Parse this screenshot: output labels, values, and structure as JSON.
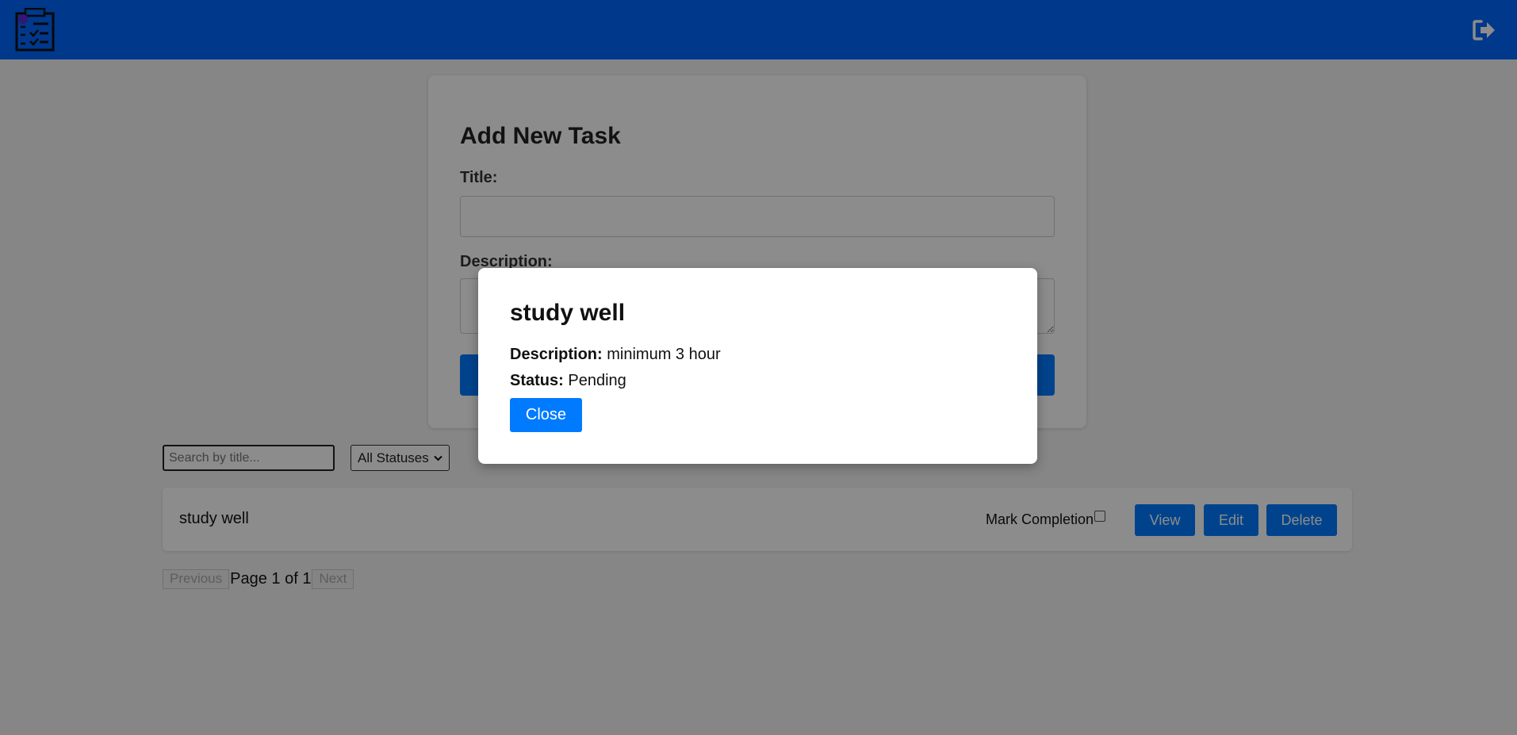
{
  "colors": {
    "navbar": "#0066ff",
    "primary_button": "#007bff",
    "page_background": "#f4f4f4",
    "overlay": "rgba(0,0,0,0.45)"
  },
  "navbar": {
    "logo_icon": "task-checklist-icon",
    "logout_icon": "sign-out-icon"
  },
  "form": {
    "heading": "Add New Task",
    "title_label": "Title:",
    "title_value": "",
    "description_label": "Description:",
    "description_value": ""
  },
  "filters": {
    "search_placeholder": "Search by title...",
    "search_value": "",
    "status_selected": "All Statuses"
  },
  "tasks": [
    {
      "title": "study well",
      "mark_completion_label": "Mark Completion",
      "completed": false,
      "view_label": "View",
      "edit_label": "Edit",
      "delete_label": "Delete"
    }
  ],
  "pagination": {
    "previous_label": "Previous",
    "page_text": "Page 1 of 1",
    "next_label": "Next"
  },
  "modal": {
    "title": "study well",
    "description_label": "Description:",
    "description_value": "minimum 3 hour",
    "status_label": "Status:",
    "status_value": "Pending",
    "close_label": "Close"
  }
}
